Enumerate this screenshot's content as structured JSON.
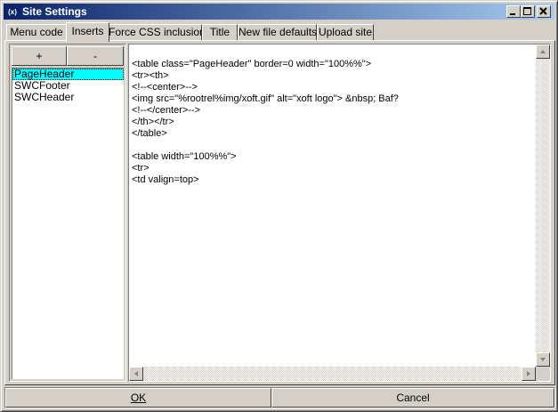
{
  "window": {
    "title": "Site Settings",
    "icons": {
      "app": "xoft-app-icon",
      "minimize": "minimize-icon",
      "maximize": "maximize-icon",
      "close": "close-icon"
    }
  },
  "tabs": [
    {
      "label": "Menu code"
    },
    {
      "label": "Inserts",
      "active": true
    },
    {
      "label": "Force CSS inclusion"
    },
    {
      "label": "Title"
    },
    {
      "label": "New file defaults"
    },
    {
      "label": "Upload site"
    }
  ],
  "inserts": {
    "add_label": "+",
    "remove_label": "-",
    "items": [
      "PageHeader",
      "SWCFooter",
      "SWCHeader"
    ],
    "selected": "PageHeader"
  },
  "editor": {
    "content": "<table class=\"PageHeader\" border=0 width=\"100%%\">\n<tr><th>\n<!--<center>-->\n<img src=\"%rootrel%img/xoft.gif\" alt=\"xoft logo\"> &nbsp; Baf?\n<!--</center>-->\n</th></tr>\n</table>\n\n<table width=\"100%%\">\n<tr>\n<td valign=top>"
  },
  "footer": {
    "ok_label": "OK",
    "cancel_label": "Cancel"
  },
  "colors": {
    "selection": "#00ffff",
    "titlebar_start": "#0a246a",
    "titlebar_end": "#a6caf0",
    "face": "#d4d0c8"
  }
}
